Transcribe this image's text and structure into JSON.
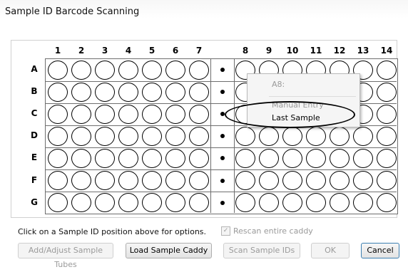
{
  "window": {
    "title": "Sample ID Barcode Scanning"
  },
  "plate": {
    "left_columns": [
      "1",
      "2",
      "3",
      "4",
      "5",
      "6",
      "7"
    ],
    "right_columns": [
      "8",
      "9",
      "10",
      "11",
      "12",
      "13",
      "14"
    ],
    "rows": [
      "A",
      "B",
      "C",
      "D",
      "E",
      "F",
      "G"
    ]
  },
  "context_menu": {
    "header": "A8:",
    "items": [
      {
        "label": "Manual Entry",
        "enabled": false
      },
      {
        "label": "Last Sample",
        "enabled": true
      }
    ]
  },
  "footer": {
    "hint": "Click on a Sample ID position above for options.",
    "rescan_label": "Rescan entire caddy",
    "rescan_checked": true
  },
  "buttons": {
    "add_adjust": "Add/Adjust Sample Tubes",
    "load_caddy": "Load Sample Caddy",
    "scan_ids": "Scan Sample IDs",
    "ok": "OK",
    "cancel": "Cancel"
  },
  "colors": {
    "accent_border": "#3c7fb1",
    "disabled_text": "#9a9a9a"
  }
}
